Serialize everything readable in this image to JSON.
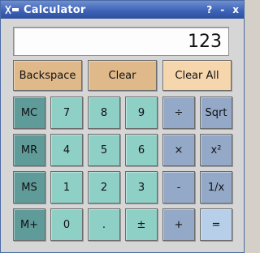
{
  "window": {
    "title": "Calculator",
    "title_buttons": {
      "help": "?",
      "minimize": "-",
      "close": "x"
    }
  },
  "display": {
    "value": "123"
  },
  "top_buttons": {
    "backspace": "Backspace",
    "clear": "Clear",
    "clear_all": "Clear All"
  },
  "keys": {
    "mc": "MC",
    "mr": "MR",
    "ms": "MS",
    "mplus": "M+",
    "k7": "7",
    "k8": "8",
    "k9": "9",
    "k4": "4",
    "k5": "5",
    "k6": "6",
    "k1": "1",
    "k2": "2",
    "k3": "3",
    "k0": "0",
    "dot": ".",
    "plusminus": "±",
    "div": "÷",
    "mul": "×",
    "sub": "-",
    "add": "+",
    "sqrt": "Sqrt",
    "square": "x²",
    "recip": "1/x",
    "equals": "="
  },
  "colors": {
    "title_bar": "#3f63b8",
    "memory_keys": "#5f9b99",
    "number_keys": "#8ecfc6",
    "operator_keys": "#93a9c7",
    "equals_key": "#b7cfe8",
    "clear_keys": "#dfb98a",
    "clear_all_key": "#f5d6ad"
  }
}
